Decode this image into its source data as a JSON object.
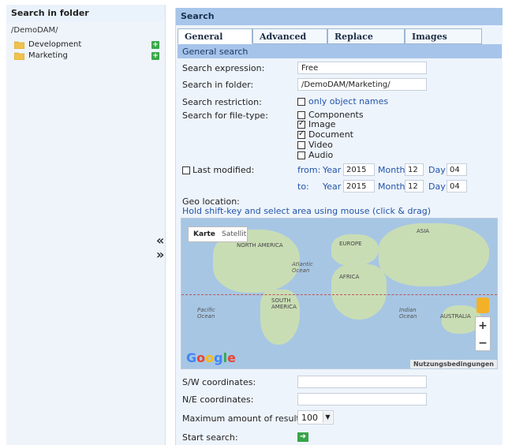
{
  "left": {
    "title": "Search in folder",
    "path": "/DemoDAM/",
    "items": [
      {
        "label": "Development"
      },
      {
        "label": "Marketing"
      }
    ]
  },
  "collapse": {
    "left": "«",
    "right": "»"
  },
  "right": {
    "title": "Search",
    "tabs": [
      {
        "label": "General",
        "active": true
      },
      {
        "label": "Advanced"
      },
      {
        "label": "Replace"
      },
      {
        "label": "Images"
      }
    ],
    "section_head": "General search",
    "search_expression_label": "Search expression:",
    "search_expression_value": "Free",
    "search_in_folder_label": "Search in folder:",
    "search_in_folder_value": "/DemoDAM/Marketing/",
    "restriction_label": "Search restriction:",
    "restriction_option": "only object names",
    "filetype_label": "Search for file-type:",
    "filetypes": [
      {
        "label": "Components",
        "checked": false
      },
      {
        "label": "Image",
        "checked": true
      },
      {
        "label": "Document",
        "checked": true
      },
      {
        "label": "Video",
        "checked": false
      },
      {
        "label": "Audio",
        "checked": false
      }
    ],
    "last_modified_label": "Last modified:",
    "from_label": "from:",
    "to_label": "to:",
    "year_label": "Year",
    "month_label": "Month",
    "day_label": "Day",
    "from": {
      "year": "2015",
      "month": "12",
      "day": "04"
    },
    "to": {
      "year": "2015",
      "month": "12",
      "day": "04"
    },
    "geo_label": "Geo location:",
    "geo_hint": "Hold shift-key and select area using mouse (click & drag)",
    "map": {
      "karte": "Karte",
      "satellit": "Satellit",
      "google": "Google",
      "terms": "Nutzungsbedingungen",
      "labels": {
        "north_america": "NORTH AMERICA",
        "europe": "EUROPE",
        "asia": "ASIA",
        "africa": "AFRICA",
        "south_america": "SOUTH AMERICA",
        "australia": "AUSTRALIA",
        "atlantic": "Atlantic Ocean",
        "pacific": "Pacific Ocean",
        "indian": "Indian Ocean"
      },
      "zoom_in": "+",
      "zoom_out": "−"
    },
    "sw_label": "S/W coordinates:",
    "sw_value": "",
    "ne_label": "N/E coordinates:",
    "ne_value": "",
    "max_label": "Maximum amount of results:",
    "max_value": "100",
    "start_label": "Start search:"
  },
  "colors": {
    "header_blue": "#a8c6ea",
    "panel_bg": "#eef4fc",
    "link_blue": "#2255aa",
    "go_green": "#36a548"
  }
}
